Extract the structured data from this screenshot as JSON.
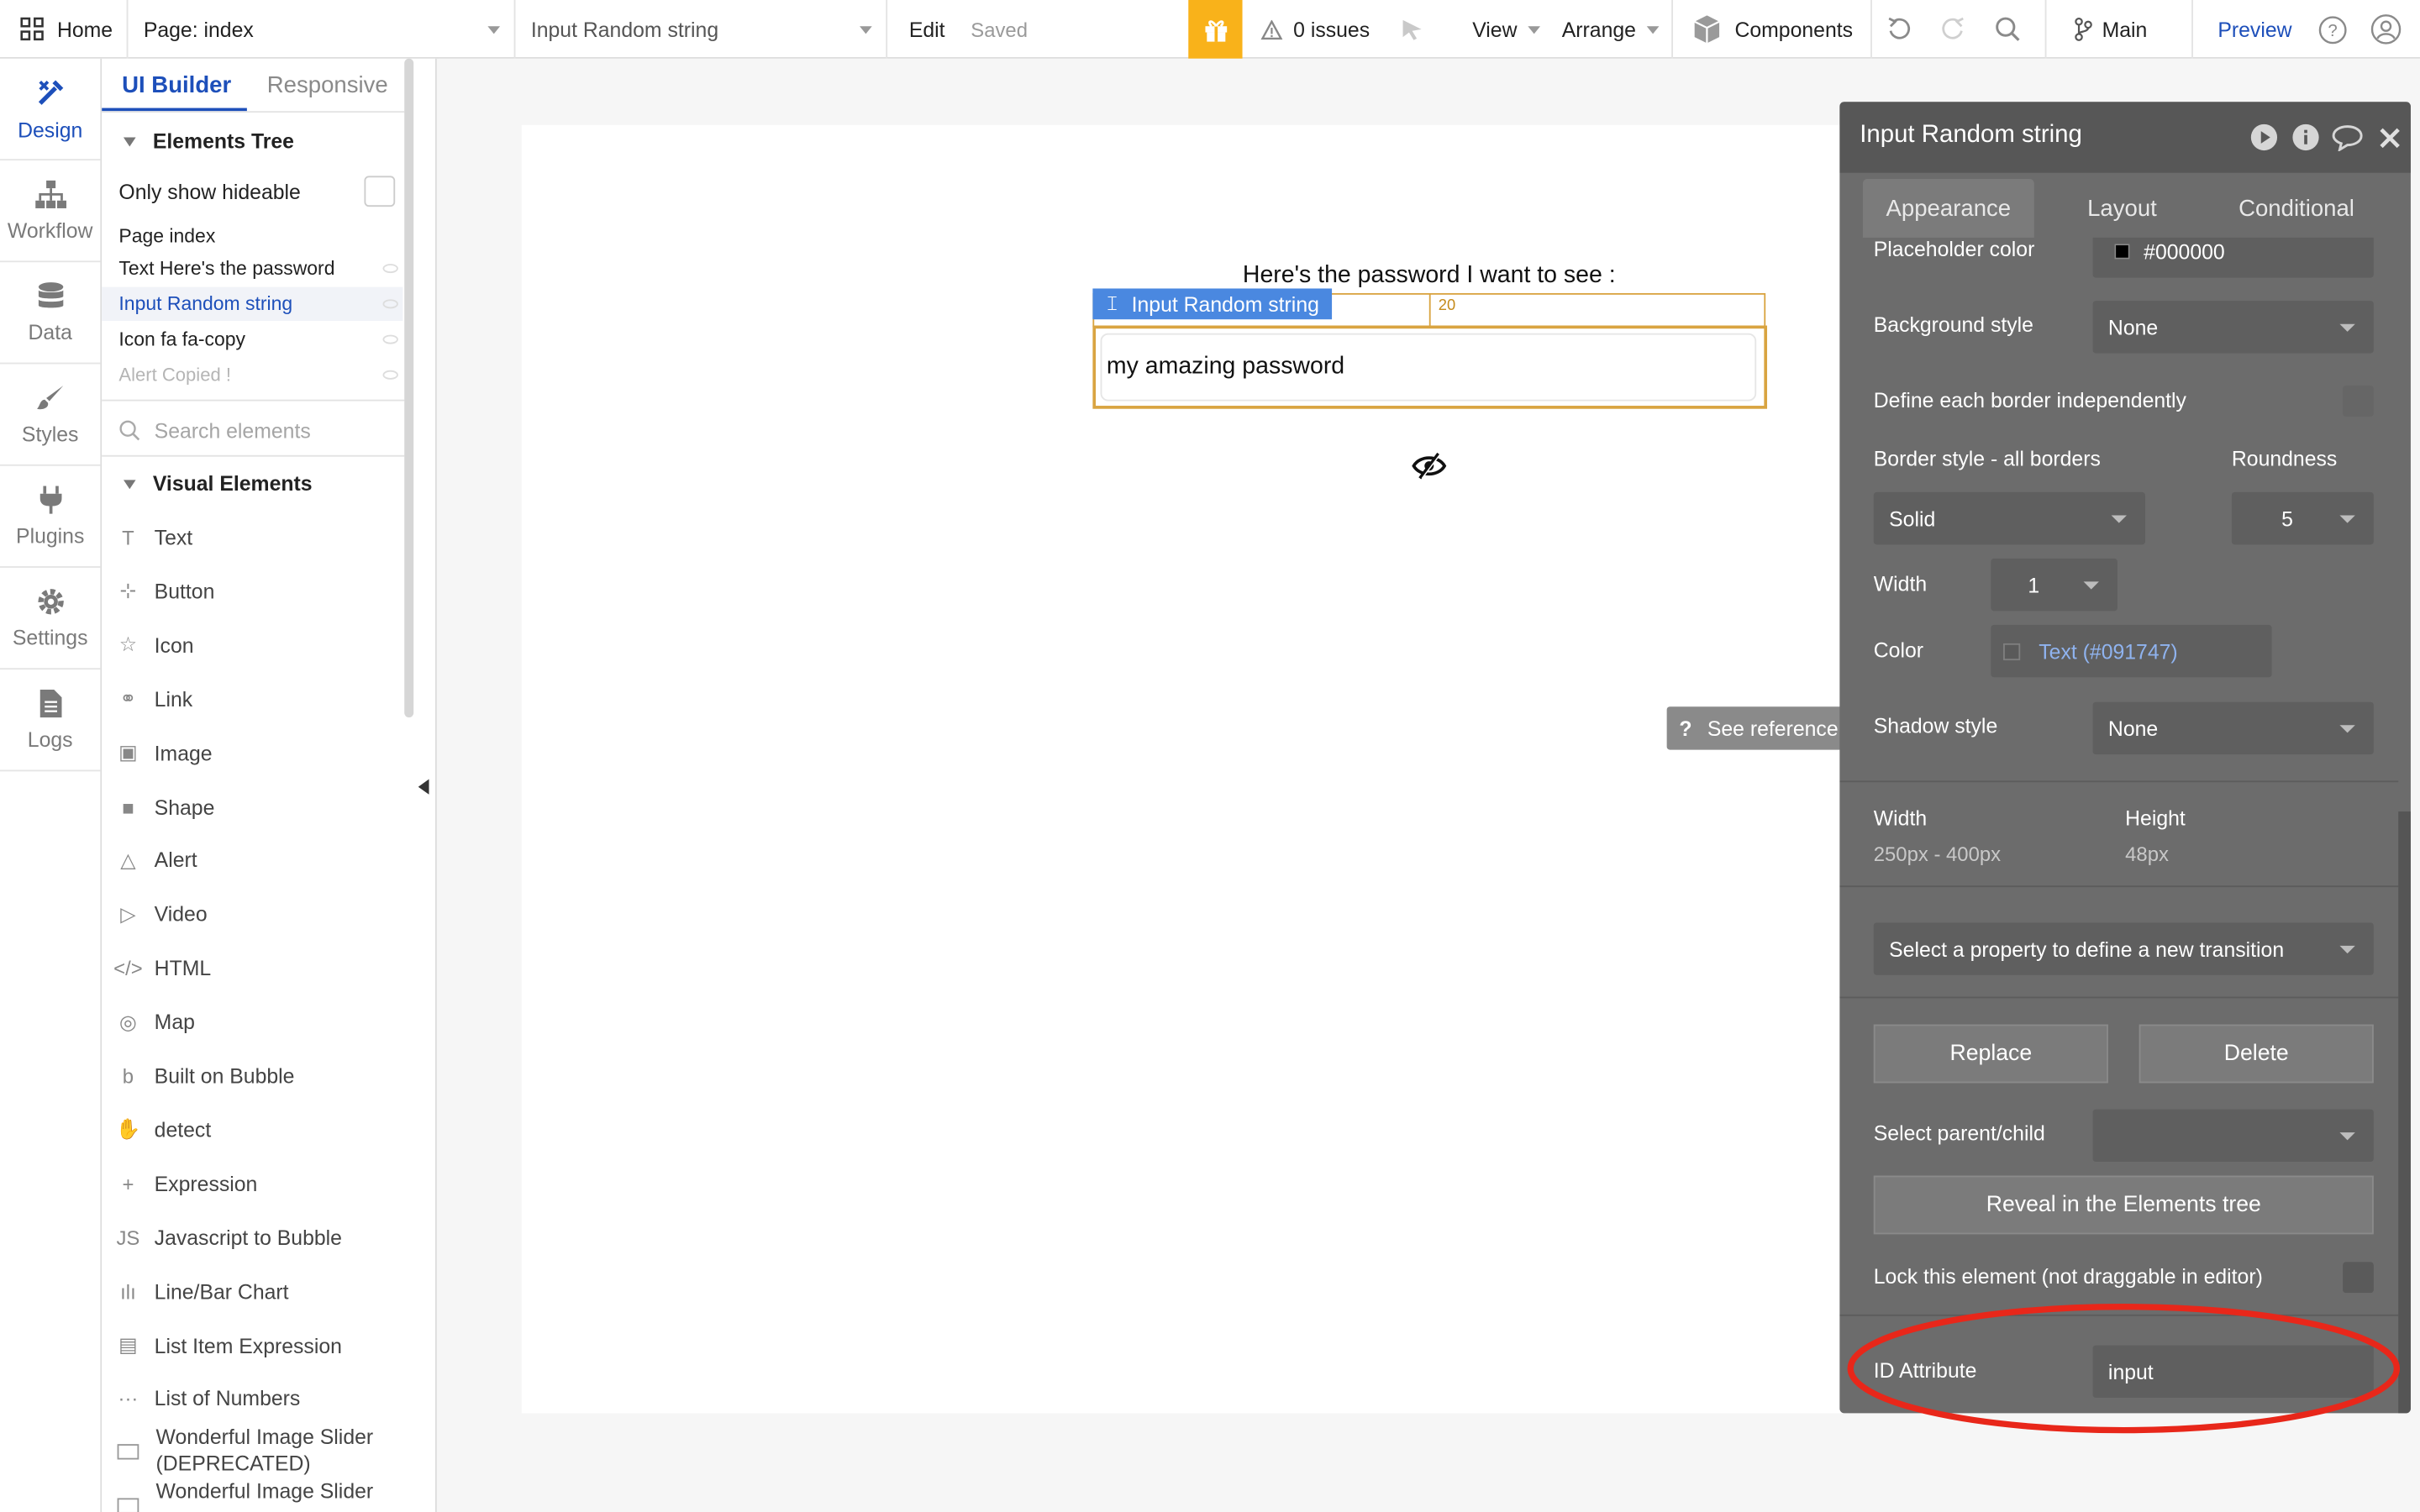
{
  "topbar": {
    "home_label": "Home",
    "page_label": "Page: index",
    "element_select": "Input Random string",
    "edit_label": "Edit",
    "saved_label": "Saved",
    "issues_label": "0 issues",
    "view_label": "View",
    "arrange_label": "Arrange",
    "components_label": "Components",
    "branch_label": "Main",
    "preview_label": "Preview"
  },
  "rail": {
    "items": [
      {
        "label": "Design"
      },
      {
        "label": "Workflow"
      },
      {
        "label": "Data"
      },
      {
        "label": "Styles"
      },
      {
        "label": "Plugins"
      },
      {
        "label": "Settings"
      },
      {
        "label": "Logs"
      }
    ]
  },
  "panel": {
    "tabs": {
      "builder": "UI Builder",
      "responsive": "Responsive"
    },
    "tree_title": "Elements Tree",
    "only_hideable": "Only show hideable",
    "tree": [
      {
        "label": "Page index"
      },
      {
        "label": "Text Here's the password"
      },
      {
        "label": "Input Random string"
      },
      {
        "label": "Icon fa fa-copy"
      },
      {
        "label": "Alert Copied !"
      }
    ],
    "search_placeholder": "Search elements",
    "visual_title": "Visual Elements",
    "visual": [
      {
        "label": "Text",
        "icon": "T"
      },
      {
        "label": "Button",
        "icon": "⊹"
      },
      {
        "label": "Icon",
        "icon": "☆"
      },
      {
        "label": "Link",
        "icon": "⚭"
      },
      {
        "label": "Image",
        "icon": "▣"
      },
      {
        "label": "Shape",
        "icon": "■"
      },
      {
        "label": "Alert",
        "icon": "△"
      },
      {
        "label": "Video",
        "icon": "▷"
      },
      {
        "label": "HTML",
        "icon": "</>"
      },
      {
        "label": "Map",
        "icon": "◎"
      },
      {
        "label": "Built on Bubble",
        "icon": "b"
      },
      {
        "label": "detect",
        "icon": "✋"
      },
      {
        "label": "Expression",
        "icon": "+"
      },
      {
        "label": "Javascript to Bubble",
        "icon": "JS"
      },
      {
        "label": "Line/Bar Chart",
        "icon": "ılı"
      },
      {
        "label": "List Item Expression",
        "icon": "▤"
      },
      {
        "label": "List of Numbers",
        "icon": "···"
      }
    ],
    "wonderful_1": "Wonderful Image Slider",
    "wonderful_1b": "(DEPRECATED)",
    "wonderful_2": "Wonderful Image Slider"
  },
  "canvas": {
    "heading": "Here's the password I want to see :",
    "selected_label": "Input Random string",
    "height_badge": "20",
    "input_value": "my amazing password",
    "see_reference": "See reference →"
  },
  "editor": {
    "title": "Input Random string",
    "tabs": {
      "appearance": "Appearance",
      "layout": "Layout",
      "conditional": "Conditional"
    },
    "placeholder_color_label": "Placeholder color",
    "placeholder_color_value": "#000000",
    "background_style_label": "Background style",
    "background_style_value": "None",
    "define_border_label": "Define each border independently",
    "border_style_label": "Border style - all borders",
    "roundness_label": "Roundness",
    "border_style_value": "Solid",
    "roundness_value": "5",
    "width_label": "Width",
    "width_value": "1",
    "color_label": "Color",
    "color_value": "Text (#091747)",
    "shadow_label": "Shadow style",
    "shadow_value": "None",
    "size_width_label": "Width",
    "size_width_value": "250px - 400px",
    "size_height_label": "Height",
    "size_height_value": "48px",
    "transition_value": "Select a property to define a new transition",
    "replace_label": "Replace",
    "delete_label": "Delete",
    "parent_child_label": "Select parent/child",
    "reveal_label": "Reveal in the Elements tree",
    "lock_label": "Lock this element (not draggable in editor)",
    "id_attr_label": "ID Attribute",
    "id_attr_value": "input"
  },
  "colors": {
    "accent_blue": "#1d4fba",
    "gift_orange": "#f9b21a",
    "selection_orange": "#d9a441",
    "selection_blue": "#4a88e0",
    "annotation_red": "#e8271a",
    "editor_bg": "#6c6c6c"
  }
}
